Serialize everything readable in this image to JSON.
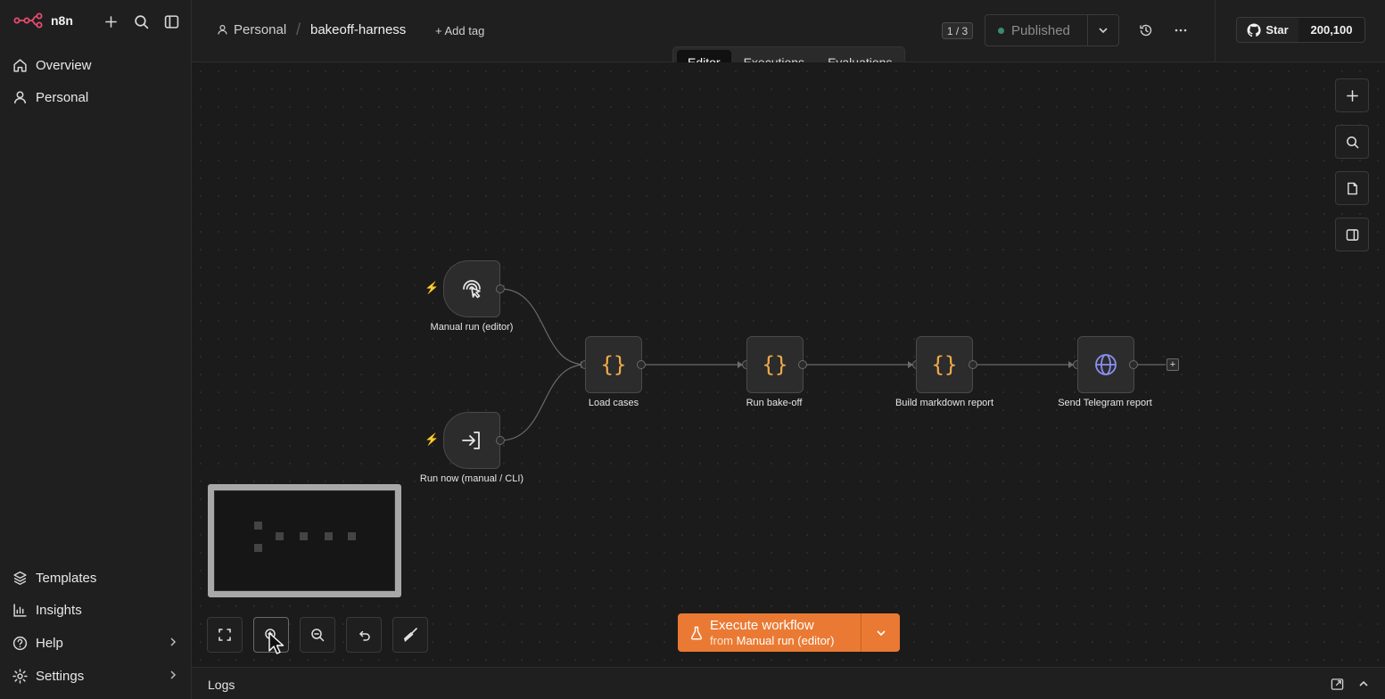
{
  "app": {
    "brand": "n8n"
  },
  "sidebar": {
    "items": [
      {
        "label": "Overview"
      },
      {
        "label": "Personal"
      }
    ],
    "bottom": [
      {
        "label": "Templates"
      },
      {
        "label": "Insights"
      },
      {
        "label": "Help"
      },
      {
        "label": "Settings"
      }
    ]
  },
  "header": {
    "project": "Personal",
    "workflow_title": "bakeoff-harness",
    "add_tag": "+ Add tag",
    "version": "1 / 3",
    "status": "Published",
    "github_star": "Star",
    "github_count": "200,100"
  },
  "tabs": [
    {
      "label": "Editor",
      "active": true
    },
    {
      "label": "Executions"
    },
    {
      "label": "Evaluations"
    }
  ],
  "nodes": {
    "manual_run": "Manual run (editor)",
    "run_now": "Run now (manual / CLI)",
    "load_cases": "Load cases",
    "run_bakeoff": "Run bake-off",
    "build_report": "Build markdown report",
    "send_telegram": "Send Telegram report"
  },
  "execute": {
    "label": "Execute workflow",
    "from_prefix": "from",
    "from_node": "Manual run (editor)"
  },
  "logs": {
    "label": "Logs"
  },
  "colors": {
    "accent": "#ea7a33",
    "code_icon": "#f0a94b",
    "globe_icon": "#8b8ff2",
    "published_dot": "#3d8a72"
  }
}
